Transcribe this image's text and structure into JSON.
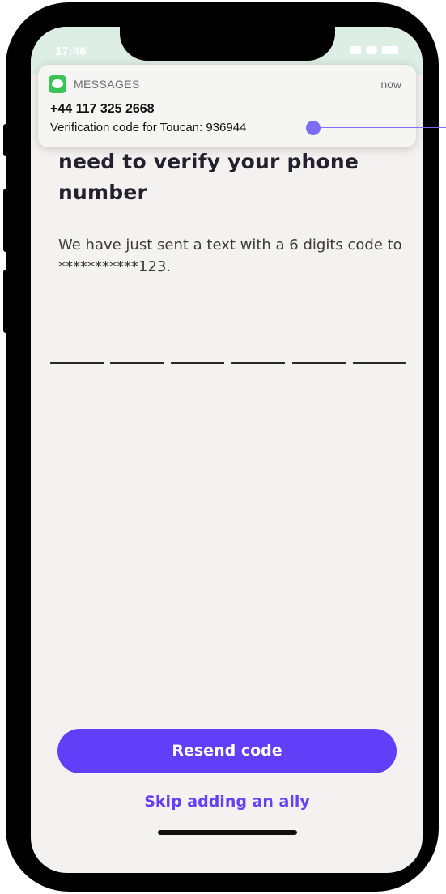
{
  "status_bar": {
    "time": "17:46"
  },
  "notification": {
    "app_name": "MESSAGES",
    "time": "now",
    "sender": "+44 117 325 2668",
    "body": "Verification code for Toucan: 936944"
  },
  "main": {
    "title_lines": [
      "need to verify your phone",
      "number"
    ],
    "description": "We have just sent a text with a 6 digits code to ***********123.",
    "code_slots": 6,
    "resend_label": "Resend code",
    "skip_label": "Skip adding an ally"
  },
  "colors": {
    "accent": "#613ff9",
    "background": "#f4f2f1",
    "notification_icon": "#3ac356",
    "pointer": "#7b6ef5"
  },
  "icons": [
    "messages-icon",
    "location-arrow-icon",
    "signal-icon",
    "wifi-icon",
    "battery-icon"
  ]
}
